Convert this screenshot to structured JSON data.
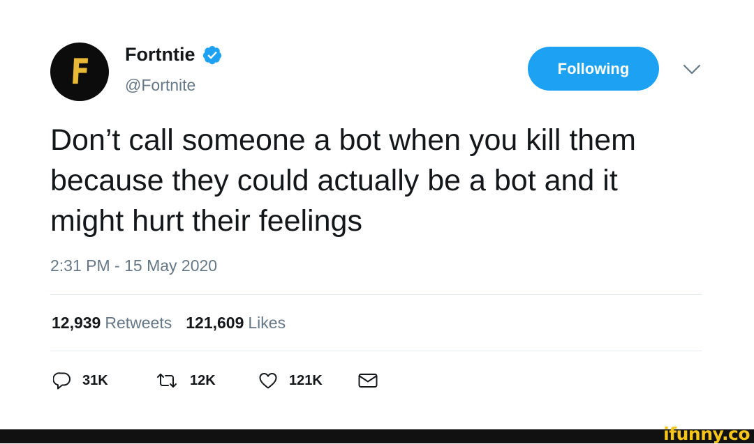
{
  "tweet": {
    "display_name": "Fortntie",
    "handle": "@Fortnite",
    "verified": true,
    "avatar_letter": "F",
    "follow_button_label": "Following",
    "text": "Don’t call someone a bot when you kill them because they could actually be a bot and it might hurt their feelings",
    "timestamp": "2:31 PM - 15 May 2020",
    "stats": {
      "retweets_count": "12,939",
      "retweets_label": "Retweets",
      "likes_count": "121,609",
      "likes_label": "Likes"
    },
    "actions": {
      "reply_count": "31K",
      "retweet_count": "12K",
      "like_count": "121K"
    }
  },
  "watermark": "ifunny.co",
  "colors": {
    "accent": "#1da1f2",
    "secondary_text": "#657786",
    "avatar_logo": "#e8b936",
    "watermark": "#f5c518"
  },
  "icons": [
    "verified-badge-icon",
    "chevron-down-icon",
    "reply-icon",
    "retweet-icon",
    "like-icon",
    "message-icon"
  ]
}
